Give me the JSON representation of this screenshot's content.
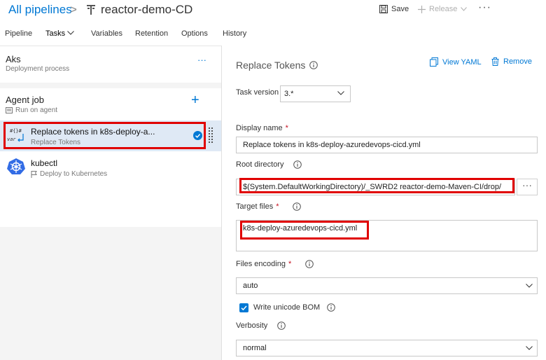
{
  "header": {
    "breadcrumb_root": "All pipelines",
    "breadcrumb_sep": ">",
    "pipeline_name": "reactor-demo-CD",
    "save_label": "Save",
    "release_label": "Release",
    "more_label": "···"
  },
  "tabs": [
    {
      "label": "Pipeline"
    },
    {
      "label": "Tasks"
    },
    {
      "label": "Variables"
    },
    {
      "label": "Retention"
    },
    {
      "label": "Options"
    },
    {
      "label": "History"
    }
  ],
  "active_tab": "Tasks",
  "stage": {
    "name": "Aks",
    "subtitle": "Deployment process",
    "more_label": "···"
  },
  "agent_job": {
    "name": "Agent job",
    "subtitle": "Run on agent",
    "add_label": "+"
  },
  "tasks": [
    {
      "title": "Replace tokens in k8s-deploy-a...",
      "subtitle": "Replace Tokens",
      "icon_text_top": "#{}#",
      "icon_text_bottom": "var",
      "selected": true
    },
    {
      "title": "kubectl",
      "subtitle": "Deploy to Kubernetes",
      "selected": false
    }
  ],
  "detail": {
    "title": "Replace Tokens",
    "view_yaml_label": "View YAML",
    "remove_label": "Remove",
    "task_version_label": "Task version",
    "task_version_value": "3.*",
    "display_name_label": "Display name",
    "display_name_value": "Replace tokens in k8s-deploy-azuredevops-cicd.yml",
    "root_directory_label": "Root directory",
    "root_directory_value": "$(System.DefaultWorkingDirectory)/_SWRD2 reactor-demo-Maven-CI/drop/",
    "root_directory_button": "···",
    "target_files_label": "Target files",
    "target_files_value": "k8s-deploy-azuredevops-cicd.yml",
    "files_encoding_label": "Files encoding",
    "files_encoding_value": "auto",
    "write_bom_label": "Write unicode BOM",
    "write_bom_checked": true,
    "verbosity_label": "Verbosity",
    "verbosity_value": "normal",
    "required_mark": "*"
  },
  "colors": {
    "accent": "#0078d4",
    "highlight_box": "#e00000",
    "selected_row": "#dfe9f5",
    "left_panel_bg": "#f4f4f4"
  },
  "icons": [
    "pipeline-icon",
    "save-icon",
    "plus-icon",
    "chevron-down-icon",
    "check-circle-icon",
    "drag-handle-icon",
    "kubernetes-icon",
    "info-icon",
    "yaml-icon",
    "trash-icon",
    "checkbox-check-icon",
    "agent-icon",
    "flag-icon"
  ]
}
